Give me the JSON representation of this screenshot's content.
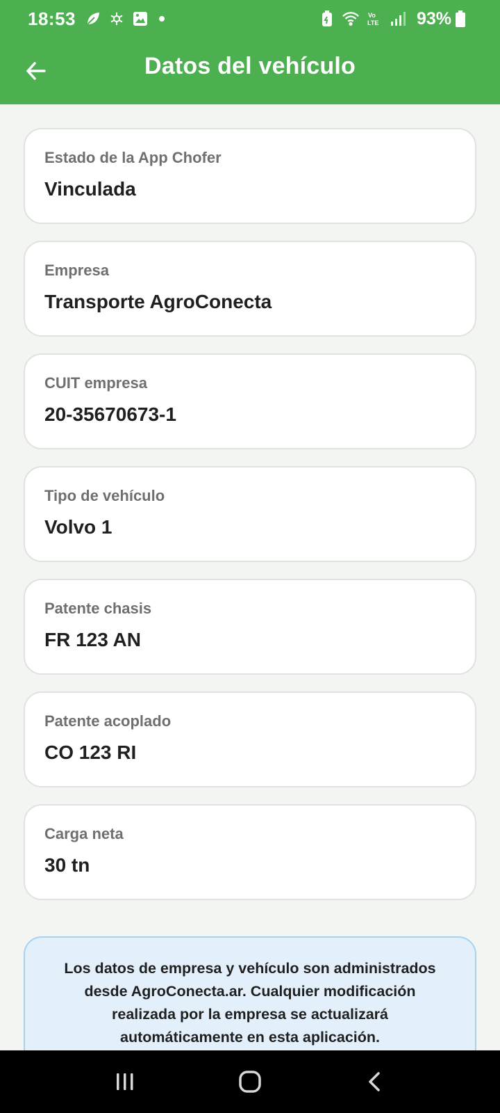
{
  "status_bar": {
    "time": "18:53",
    "battery": "93%",
    "left_icons": [
      "leaf-icon",
      "openai-icon",
      "image-icon",
      "dot-icon"
    ],
    "right_icons": [
      "battery-saver-icon",
      "wifi-icon",
      "volte-icon",
      "signal-icon",
      "battery-icon"
    ]
  },
  "app_bar": {
    "title": "Datos del vehículo",
    "back_icon": "arrow-left-icon"
  },
  "cards": [
    {
      "label": "Estado de la App Chofer",
      "value": "Vinculada"
    },
    {
      "label": "Empresa",
      "value": "Transporte AgroConecta"
    },
    {
      "label": "CUIT empresa",
      "value": "20-35670673-1"
    },
    {
      "label": "Tipo de vehículo",
      "value": "Volvo 1"
    },
    {
      "label": "Patente chasis",
      "value": "FR 123 AN"
    },
    {
      "label": "Patente acoplado",
      "value": "CO 123 RI"
    },
    {
      "label": "Carga neta",
      "value": "30 tn"
    }
  ],
  "info": {
    "line1": "Los datos de empresa y vehículo son administrados",
    "line2": "desde AgroConecta.ar. Cualquier modificación",
    "line3": "realizada por la empresa se actualizará",
    "line4": "automáticamente en esta aplicación."
  },
  "nav_bar": {
    "buttons": [
      "recent-apps-icon",
      "home-icon",
      "back-icon"
    ]
  },
  "colors": {
    "primary": "#4caf50",
    "background": "#f3f5f2",
    "card": "#ffffff",
    "info_bg": "#e3f0fb",
    "info_border": "#a6d2ef"
  }
}
